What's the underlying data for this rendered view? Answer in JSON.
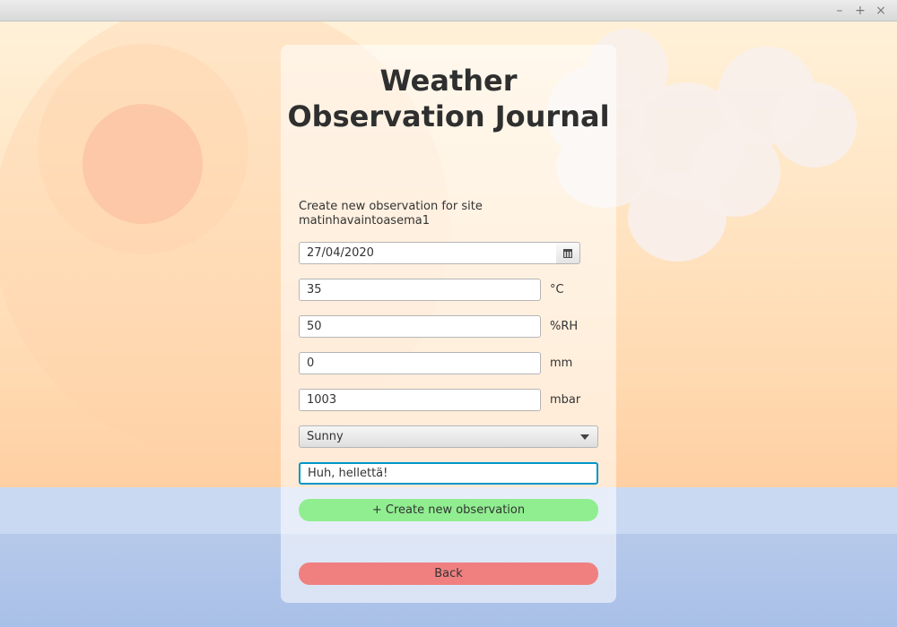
{
  "window": {
    "controls": [
      "–",
      "+",
      "×"
    ]
  },
  "form": {
    "title": "Weather Observation Journal",
    "subtitle": "Create new observation for site matinhavaintoasema1",
    "date": "27/04/2020",
    "temperature": {
      "value": "35",
      "unit": "°C"
    },
    "humidity": {
      "value": "50",
      "unit": "%RH"
    },
    "precipitation": {
      "value": "0",
      "unit": "mm"
    },
    "pressure": {
      "value": "1003",
      "unit": "mbar"
    },
    "weather": {
      "selected": "Sunny"
    },
    "notes": "Huh, hellettä!",
    "create_label": "+ Create new observation",
    "back_label": "Back"
  },
  "colors": {
    "create": "#90ee90",
    "back": "#f08080",
    "focus": "#0096c9"
  }
}
